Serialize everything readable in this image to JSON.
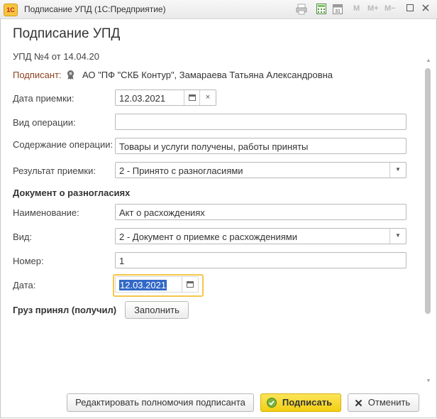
{
  "window": {
    "title": "Подписание УПД  (1С:Предприятие)",
    "app_icon": "1С",
    "toolbar_m": [
      "M",
      "M+",
      "M−"
    ],
    "calendar_day": "31"
  },
  "form": {
    "title": "Подписание УПД",
    "doc_ref": "УПД №4 от 14.04.20",
    "signer_label": "Подписант:",
    "signer_value": "АО \"ПФ \"СКБ Контур\", Замараева Татьяна Александровна"
  },
  "fields": {
    "accept_date_label": "Дата приемки:",
    "accept_date_value": "12.03.2021",
    "op_type_label": "Вид операции:",
    "op_type_value": "",
    "op_content_label": "Содержание операции:",
    "op_content_value": "Товары и услуги получены, работы приняты",
    "result_label": "Результат приемки:",
    "result_value": "2 - Принято с разногласиями"
  },
  "disagreement": {
    "section_title": "Документ о разногласиях",
    "name_label": "Наименование:",
    "name_value": "Акт о расхождениях",
    "kind_label": "Вид:",
    "kind_value": "2 - Документ о приемке с расхождениями",
    "number_label": "Номер:",
    "number_value": "1",
    "date_label": "Дата:",
    "date_value": "12.03.2021"
  },
  "cargo": {
    "label": "Груз принял (получил)",
    "fill_button": "Заполнить"
  },
  "footer": {
    "edit_authority_button": "Редактировать полномочия подписанта",
    "sign_button": "Подписать",
    "cancel_button": "Отменить"
  }
}
